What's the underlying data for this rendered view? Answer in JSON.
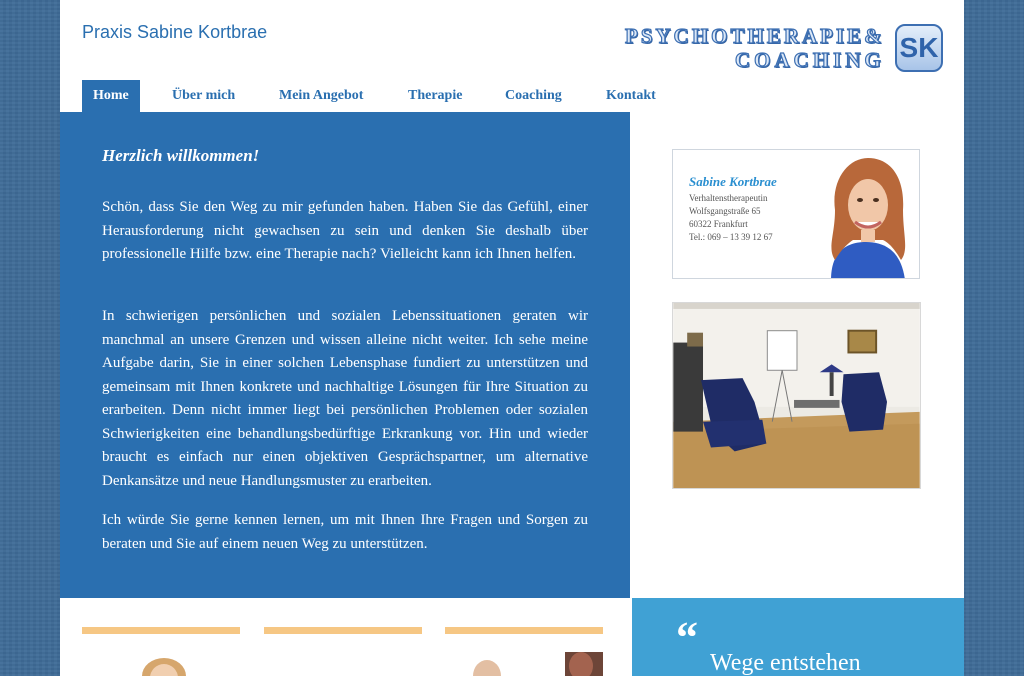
{
  "header": {
    "site_title": "Praxis Sabine Kortbrae",
    "logo_line1": "PSYCHOTHERAPIE&",
    "logo_line2": "COACHING",
    "logo_monogram": "SK"
  },
  "nav": {
    "items": [
      {
        "label": "Home",
        "active": true
      },
      {
        "label": "Über mich"
      },
      {
        "label": "Mein Angebot"
      },
      {
        "label": "Therapie"
      },
      {
        "label": "Coaching"
      },
      {
        "label": "Kontakt"
      }
    ]
  },
  "main": {
    "heading": "Herzlich willkommen!",
    "paragraphs": [
      "Schön, dass Sie den Weg zu mir gefunden haben. Haben Sie das Gefühl, ei­ner Herausforderung nicht gewachsen zu sein und denken Sie deshalb über professionelle Hilfe bzw. eine Therapie nach? Vielleicht kann ich Ihnen helfen.",
      "In schwierigen persönlichen und sozialen Lebenssituationen geraten wir manchmal an unsere Grenzen und wissen alleine nicht weiter. Ich sehe meine Aufgabe darin, Sie in einer solchen Lebensphase fundiert zu unterstützen und gemeinsam mit Ihnen konkrete und nachhaltige Lösungen für Ihre Situa­tion zu erarbeiten. Denn nicht immer liegt bei persönlichen Problemen oder sozialen Schwierigkeiten eine behandlungsbedürftige Erkrankung vor. Hin und wieder braucht es einfach nur einen objektiven Gesprächspartner, um al­ternative Denkansätze und neue Handlungsmuster zu erarbeiten.",
      "Ich würde Sie gerne kennen lernen, um mit Ihnen Ihre Fragen und Sorgen zu beraten und Sie auf einem neuen Weg zu unterstützen."
    ]
  },
  "contact_card": {
    "name": "Sabine Kortbrae",
    "title": "Verhaltenstherapeutin",
    "street": "Wolfsgangstraße 65",
    "city": "60322 Frankfurt",
    "phone": "Tel.: 069 – 13 39 12 67"
  },
  "quote": {
    "mark": "“",
    "text": "Wege entstehen"
  },
  "colors": {
    "brand_blue": "#2a6fb0",
    "quote_blue": "#40a1d4",
    "accent_orange": "#f6c784"
  }
}
